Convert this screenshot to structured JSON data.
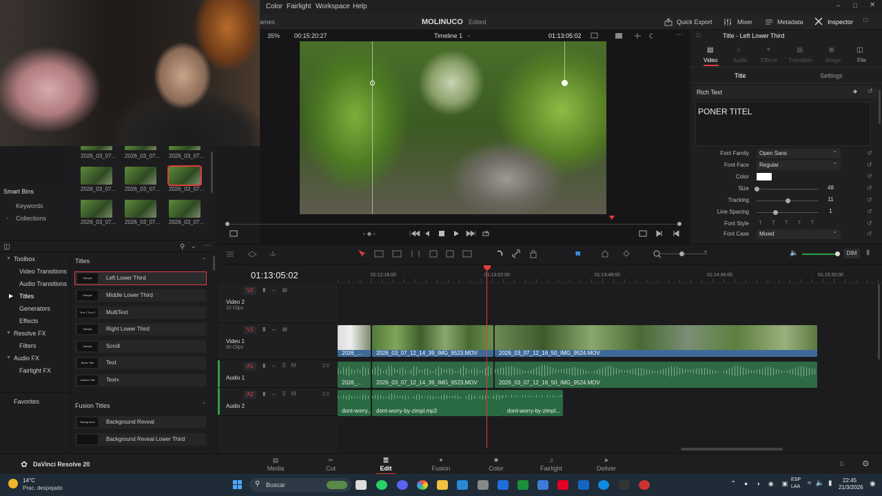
{
  "menubar": {
    "items": [
      "Color",
      "Fairlight",
      "Workspace",
      "Help"
    ]
  },
  "header": {
    "project_title": "MOLINUCO",
    "status": "Edited",
    "left_fragment": "ames",
    "quick_export": "Quick Export",
    "mixer": "Mixer",
    "metadata": "Metadata",
    "inspector": "Inspector"
  },
  "viewer": {
    "zoom": "35%",
    "source_tc": "00:15:20:27",
    "timeline_name": "Timeline 1",
    "record_tc": "01:13:05:02"
  },
  "media_pool": {
    "row_labels": [
      "2026_03_07...",
      "2026_03_07...",
      "2026_03_07..."
    ]
  },
  "smart_bins": {
    "title": "Smart Bins",
    "items": [
      "Keywords",
      "Collections"
    ]
  },
  "effects": {
    "tree": [
      "Toolbox",
      "Video Transitions",
      "Audio Transitions",
      "Titles",
      "Generators",
      "Effects",
      "Resolve FX",
      "Filters",
      "Audio FX",
      "Fairlight FX"
    ],
    "favorites": "Favorites",
    "titles_header": "Titles",
    "titles": [
      {
        "name": "Left Lower Third",
        "thumb": "Sample"
      },
      {
        "name": "Middle Lower Third",
        "thumb": "Sample"
      },
      {
        "name": "MultiText",
        "thumb": "Text 1 Text 2"
      },
      {
        "name": "Right Lower Third",
        "thumb": "Sample"
      },
      {
        "name": "Scroll",
        "thumb": "Sample"
      },
      {
        "name": "Text",
        "thumb": "Basic Title"
      },
      {
        "name": "Text+",
        "thumb": "Custom Title"
      }
    ],
    "fusion_header": "Fusion Titles",
    "fusion": [
      {
        "name": "Background Reveal",
        "thumb": "Background Reveal"
      },
      {
        "name": "Background Reveal Lower Third",
        "thumb": ""
      }
    ]
  },
  "inspector": {
    "title": "Title - Left Lower Third",
    "tabs": [
      "Video",
      "Audio",
      "Effects",
      "Transition",
      "Image",
      "File"
    ],
    "subtabs": [
      "Title",
      "Settings"
    ],
    "section": "Rich Text",
    "text": "PONER TITEL",
    "font_family_label": "Font Family",
    "font_family": "Open Sans",
    "font_face_label": "Font Face",
    "font_face": "Regular",
    "color_label": "Color",
    "size_label": "Size",
    "size": "48",
    "tracking_label": "Tracking",
    "tracking": "11",
    "line_spacing_label": "Line Spacing",
    "line_spacing": "1",
    "font_style_label": "Font Style",
    "font_case_label": "Font Case",
    "font_case": "Mixed"
  },
  "timeline": {
    "timecode": "01:13:05:02",
    "ruler": [
      "01:12:16:00",
      "01:13:02:00",
      "01:13:48:00",
      "01:14:34:00",
      "01:15:20:00"
    ],
    "dim": "DIM",
    "tracks": [
      {
        "id": "V2",
        "name": "Video 2",
        "clips": "10 Clips"
      },
      {
        "id": "V1",
        "name": "Video 1",
        "clips": "90 Clips"
      },
      {
        "id": "A1",
        "name": "Audio 1",
        "level": "2.0"
      },
      {
        "id": "A2",
        "name": "Audio 2",
        "level": "2.0"
      }
    ],
    "v1_clips": [
      "2026_...",
      "2026_03_07_12_14_39_IMG_9523.MOV",
      "2026_03_07_12_16_50_IMG_9524.MOV"
    ],
    "a1_clips": [
      "2026_...",
      "2026_03_07_12_14_39_IMG_9523.MOV",
      "2026_03_07_12_16_50_IMG_9524.MOV"
    ],
    "a2_clips": [
      "dont-worry...",
      "dont-worry-by-zimpl.mp3",
      "dont-worry-by-zimpl..."
    ]
  },
  "pages": {
    "app": "DaVinci Resolve 20",
    "tabs": [
      "Media",
      "Cut",
      "Edit",
      "Fusion",
      "Color",
      "Fairlight",
      "Deliver"
    ],
    "active": "Edit"
  },
  "taskbar": {
    "weather_temp": "14°C",
    "weather_desc": "Prac. despejado",
    "search": "Buscar",
    "lang1": "ESP",
    "lang2": "LAA",
    "time": "22:45",
    "date": "21/3/2026"
  }
}
